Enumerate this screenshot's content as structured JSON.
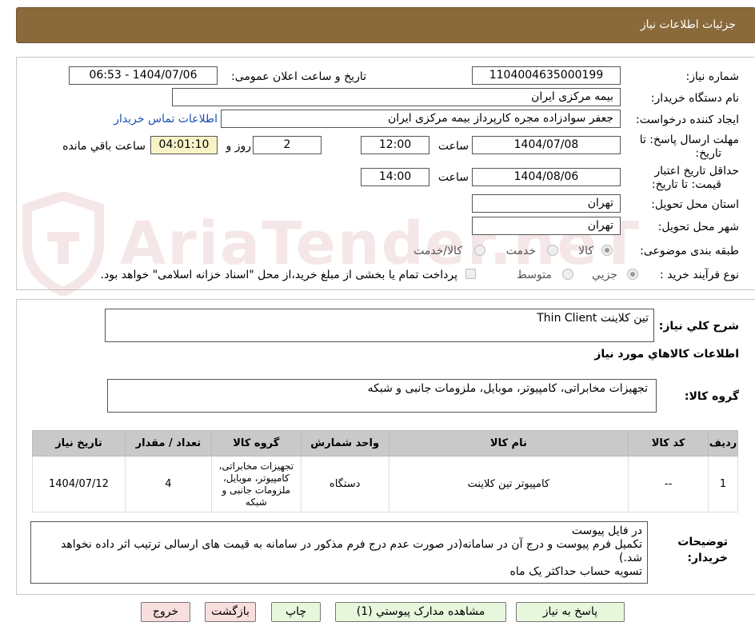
{
  "header": {
    "title": "جزئیات اطلاعات نیاز"
  },
  "watermark": "AriaTender.neT",
  "form": {
    "need_number_label": "شماره نیاز:",
    "need_number": "1104004635000199",
    "announce_label": "تاریخ و ساعت اعلان عمومی:",
    "announce_value": "1404/07/06 - 06:53",
    "buyer_label": "نام دستگاه خریدار:",
    "buyer": "بیمه مرکزی ایران",
    "creator_label": "ایجاد کننده درخواست:",
    "creator": "جعفر سوادزاده مجره کارپرداز بیمه مرکزی ایران",
    "contact_link": "اطلاعات تماس خریدار",
    "deadline_label_1": "مهلت ارسال پاسخ: تا",
    "deadline_label_2": "تاریخ:",
    "deadline_date": "1404/07/08",
    "time_label": "ساعت",
    "deadline_time": "12:00",
    "days_value": "2",
    "days_label": "روز و",
    "remaining_time": "04:01:10",
    "remaining_label": "ساعت باقي مانده",
    "validity_label_1": "حداقل تاریخ اعتبار",
    "validity_label_2": "قیمت: تا تاریخ:",
    "validity_date": "1404/08/06",
    "validity_time": "14:00",
    "province_label": "استان محل تحویل:",
    "province": "تهران",
    "city_label": "شهر محل تحویل:",
    "city": "تهران",
    "category_label": "طبقه بندی موضوعی:",
    "category_options": [
      "کالا",
      "خدمت",
      "کالا/خدمت"
    ],
    "process_label": "نوع فرآیند خرید :",
    "process_options": [
      "جزیي",
      "متوسط"
    ],
    "payment_note": "پرداخت تمام یا بخشی از مبلغ خرید،از محل \"اسناد خزانه اسلامی\" خواهد بود."
  },
  "details": {
    "summary_label": "شرح کلي نیاز:",
    "summary": "تین کلاینت Thin Client",
    "goods_info_title": "اطلاعات کالاهاي مورد نیاز",
    "group_label": "گروه کالا:",
    "group": "تجهیزات مخابراتی، کامپیوتر، موبایل، ملزومات جانبی و شبکه",
    "table": {
      "headers": [
        "ردیف",
        "کد کالا",
        "نام کالا",
        "واحد شمارش",
        "گروه کالا",
        "تعداد / مقدار",
        "تاریخ نیاز"
      ],
      "rows": [
        [
          "1",
          "--",
          "کامپیوتر تین کلاینت",
          "دستگاه",
          "تجهیزات مخابراتی، کامپیوتر، موبایل، ملزومات جانبی و شبکه",
          "4",
          "1404/07/12"
        ]
      ]
    },
    "buyer_notes_label_1": "توضیحات",
    "buyer_notes_label_2": "خریدار:",
    "buyer_notes": [
      "در فایل پیوست",
      "تکمیل فرم پیوست و درج آن در سامانه(در صورت عدم درج فرم مذکور در سامانه به قیمت های ارسالی ترتیب اثر داده نخواهد شد.)",
      "تسویه حساب حداکثر یک ماه"
    ]
  },
  "buttons": {
    "reply": "پاسخ به نیاز",
    "attachments": "مشاهده مدارک پیوستي (1)",
    "print": "چاپ",
    "back": "بازگشت",
    "exit": "خروج"
  }
}
